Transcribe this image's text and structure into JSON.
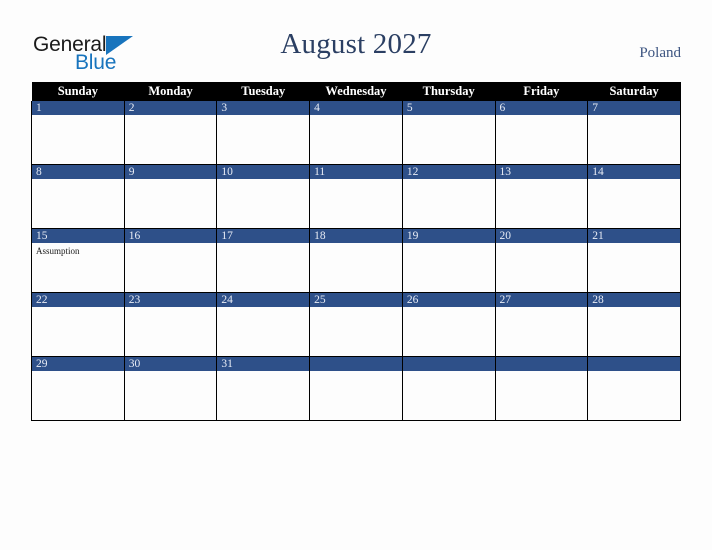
{
  "logo": {
    "word1": "General",
    "word2": "Blue",
    "triangle_color": "#1874bd",
    "text_color": "#1b1b1b"
  },
  "header": {
    "title": "August 2027",
    "country": "Poland",
    "title_color": "#2b3f63"
  },
  "calendar": {
    "weekday_headers": [
      "Sunday",
      "Monday",
      "Tuesday",
      "Wednesday",
      "Thursday",
      "Friday",
      "Saturday"
    ],
    "header_bg": "#000000",
    "daybar_color": "#2e5089",
    "daybar_text_color": "#e8ecf5",
    "cell_bg": "#fdfdfd",
    "weeks": [
      [
        {
          "date": "1",
          "events": []
        },
        {
          "date": "2",
          "events": []
        },
        {
          "date": "3",
          "events": []
        },
        {
          "date": "4",
          "events": []
        },
        {
          "date": "5",
          "events": []
        },
        {
          "date": "6",
          "events": []
        },
        {
          "date": "7",
          "events": []
        }
      ],
      [
        {
          "date": "8",
          "events": []
        },
        {
          "date": "9",
          "events": []
        },
        {
          "date": "10",
          "events": []
        },
        {
          "date": "11",
          "events": []
        },
        {
          "date": "12",
          "events": []
        },
        {
          "date": "13",
          "events": []
        },
        {
          "date": "14",
          "events": []
        }
      ],
      [
        {
          "date": "15",
          "events": [
            "Assumption"
          ]
        },
        {
          "date": "16",
          "events": []
        },
        {
          "date": "17",
          "events": []
        },
        {
          "date": "18",
          "events": []
        },
        {
          "date": "19",
          "events": []
        },
        {
          "date": "20",
          "events": []
        },
        {
          "date": "21",
          "events": []
        }
      ],
      [
        {
          "date": "22",
          "events": []
        },
        {
          "date": "23",
          "events": []
        },
        {
          "date": "24",
          "events": []
        },
        {
          "date": "25",
          "events": []
        },
        {
          "date": "26",
          "events": []
        },
        {
          "date": "27",
          "events": []
        },
        {
          "date": "28",
          "events": []
        }
      ],
      [
        {
          "date": "29",
          "events": []
        },
        {
          "date": "30",
          "events": []
        },
        {
          "date": "31",
          "events": []
        },
        {
          "date": "",
          "events": []
        },
        {
          "date": "",
          "events": []
        },
        {
          "date": "",
          "events": []
        },
        {
          "date": "",
          "events": []
        }
      ]
    ]
  }
}
